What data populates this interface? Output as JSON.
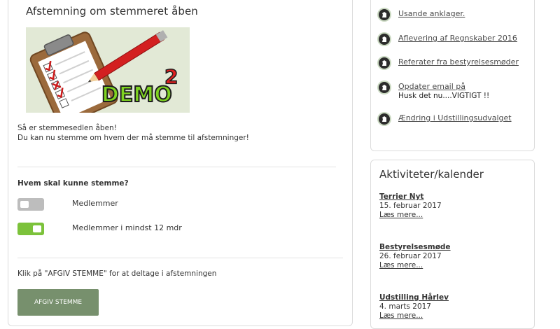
{
  "vote": {
    "title": "Afstemning om stemmeret åben",
    "image": {
      "label": "DEMO",
      "superscript": "2"
    },
    "intro": [
      "Så er stemmesedlen åben!",
      "Du kan nu stemme om hvem der må stemme til afstemninger!"
    ],
    "question": "Hvem skal kunne stemme?",
    "options": [
      {
        "label": "Medlemmer",
        "enabled": false
      },
      {
        "label": "Medlemmer i mindst 12 mdr",
        "enabled": true
      }
    ],
    "instruction": "Klik på \"AFGIV STEMME\" for at deltage i afstemningen",
    "button_label": "AFGIV STEMME",
    "colors": {
      "toggle_on": "#7cc23b",
      "toggle_off": "#bdbdbd",
      "button": "#77906d"
    }
  },
  "news": {
    "items": [
      {
        "title": "Usande anklager.",
        "sub": ""
      },
      {
        "title": "Aflevering af Regnskaber 2016",
        "sub": ""
      },
      {
        "title": "Referater fra bestyrelsesmøder",
        "sub": ""
      },
      {
        "title": "Opdater email på",
        "sub": "Husk det nu....VIGTIGT !!"
      },
      {
        "title": "Ændring i Udstillingsudvalget",
        "sub": ""
      }
    ],
    "icon": "horse-head-icon"
  },
  "calendar": {
    "title": "Aktiviteter/kalender",
    "events": [
      {
        "title": "Terrier Nyt",
        "date": "15. februar 2017",
        "more": "Læs mere..."
      },
      {
        "title": "Bestyrelsesmøde",
        "date": "26. februar 2017",
        "more": "Læs mere..."
      },
      {
        "title": "Udstilling Hårlev",
        "date": "4. marts 2017",
        "more": "Læs mere..."
      }
    ]
  }
}
